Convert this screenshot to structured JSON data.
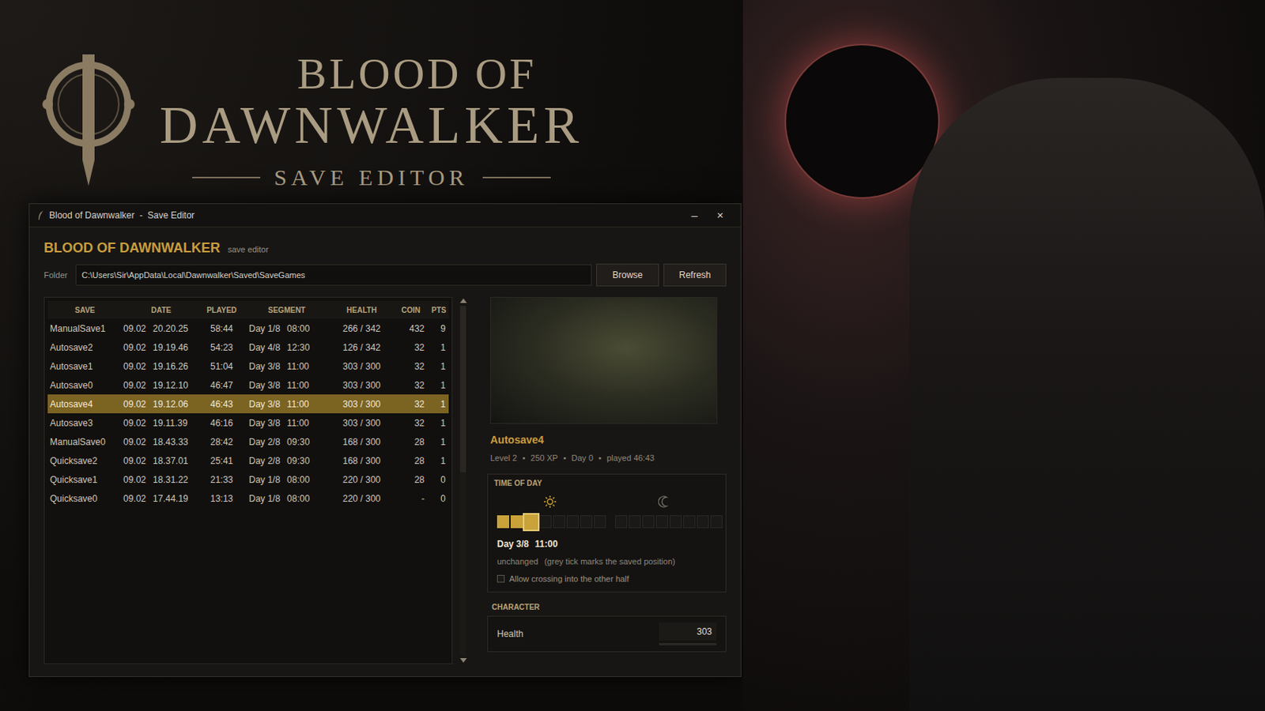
{
  "window": {
    "title": "Blood of Dawnwalker  -  Save Editor",
    "controls": [
      "–",
      "×"
    ]
  },
  "banner": {
    "title_top": "BLOOD OF",
    "title_main": "DAWNWALKER",
    "subtitle": "SAVE EDITOR"
  },
  "header": {
    "title": "BLOOD OF DAWNWALKER",
    "subtitle": "save editor"
  },
  "folder": {
    "label": "Folder",
    "path": "C:\\Users\\Sir\\AppData\\Local\\Dawnwalker\\Saved\\SaveGames",
    "buttons": [
      "Browse",
      "Refresh"
    ]
  },
  "table": {
    "columns": [
      "SAVE",
      "DATE",
      "PLAYED",
      "SEGMENT",
      "HEALTH",
      "COIN",
      "PTS"
    ],
    "rows": [
      {
        "save": "ManualSave1",
        "date": "09.02",
        "time": "20.20.25",
        "played": "58:44",
        "day": "Day 1/8",
        "clock": "08:00",
        "health": "266 / 342",
        "coin": "432",
        "pts": "9",
        "selected": false
      },
      {
        "save": "Autosave2",
        "date": "09.02",
        "time": "19.19.46",
        "played": "54:23",
        "day": "Day 4/8",
        "clock": "12:30",
        "health": "126 / 342",
        "coin": "32",
        "pts": "1",
        "selected": false
      },
      {
        "save": "Autosave1",
        "date": "09.02",
        "time": "19.16.26",
        "played": "51:04",
        "day": "Day 3/8",
        "clock": "11:00",
        "health": "303 / 300",
        "coin": "32",
        "pts": "1",
        "selected": false
      },
      {
        "save": "Autosave0",
        "date": "09.02",
        "time": "19.12.10",
        "played": "46:47",
        "day": "Day 3/8",
        "clock": "11:00",
        "health": "303 / 300",
        "coin": "32",
        "pts": "1",
        "selected": false
      },
      {
        "save": "Autosave4",
        "date": "09.02",
        "time": "19.12.06",
        "played": "46:43",
        "day": "Day 3/8",
        "clock": "11:00",
        "health": "303 / 300",
        "coin": "32",
        "pts": "1",
        "selected": true
      },
      {
        "save": "Autosave3",
        "date": "09.02",
        "time": "19.11.39",
        "played": "46:16",
        "day": "Day 3/8",
        "clock": "11:00",
        "health": "303 / 300",
        "coin": "32",
        "pts": "1",
        "selected": false
      },
      {
        "save": "ManualSave0",
        "date": "09.02",
        "time": "18.43.33",
        "played": "28:42",
        "day": "Day 2/8",
        "clock": "09:30",
        "health": "168 / 300",
        "coin": "28",
        "pts": "1",
        "selected": false
      },
      {
        "save": "Quicksave2",
        "date": "09.02",
        "time": "18.37.01",
        "played": "25:41",
        "day": "Day 2/8",
        "clock": "09:30",
        "health": "168 / 300",
        "coin": "28",
        "pts": "1",
        "selected": false
      },
      {
        "save": "Quicksave1",
        "date": "09.02",
        "time": "18.31.22",
        "played": "21:33",
        "day": "Day 1/8",
        "clock": "08:00",
        "health": "220 / 300",
        "coin": "28",
        "pts": "0",
        "selected": false
      },
      {
        "save": "Quicksave0",
        "date": "09.02",
        "time": "17.44.19",
        "played": "13:13",
        "day": "Day 1/8",
        "clock": "08:00",
        "health": "220 / 300",
        "coin": "-",
        "pts": "0",
        "selected": false
      }
    ]
  },
  "details": {
    "name": "Autosave4",
    "meta": [
      "Level 2",
      "250 XP",
      "Day 0",
      "played 46:43"
    ],
    "separator": "•",
    "time_of_day": {
      "label": "TIME OF DAY",
      "day_segments": [
        {
          "filled": true,
          "current": false
        },
        {
          "filled": true,
          "current": false
        },
        {
          "filled": true,
          "current": true
        },
        {
          "filled": false,
          "current": false
        },
        {
          "filled": false,
          "current": false
        },
        {
          "filled": false,
          "current": false
        },
        {
          "filled": false,
          "current": false
        },
        {
          "filled": false,
          "current": false
        }
      ],
      "night_segments": [
        {
          "filled": false,
          "current": false
        },
        {
          "filled": false,
          "current": false
        },
        {
          "filled": false,
          "current": false
        },
        {
          "filled": false,
          "current": false
        },
        {
          "filled": false,
          "current": false
        },
        {
          "filled": false,
          "current": false
        },
        {
          "filled": false,
          "current": false
        },
        {
          "filled": false,
          "current": false
        }
      ],
      "day": "Day 3/8",
      "clock": "11:00",
      "status": "unchanged",
      "hint": "(grey tick marks the saved position)",
      "checkbox": {
        "label": "Allow crossing into the other half",
        "checked": false
      }
    },
    "character": {
      "label": "CHARACTER",
      "fields": [
        {
          "label": "Health",
          "value": "303"
        }
      ]
    }
  }
}
